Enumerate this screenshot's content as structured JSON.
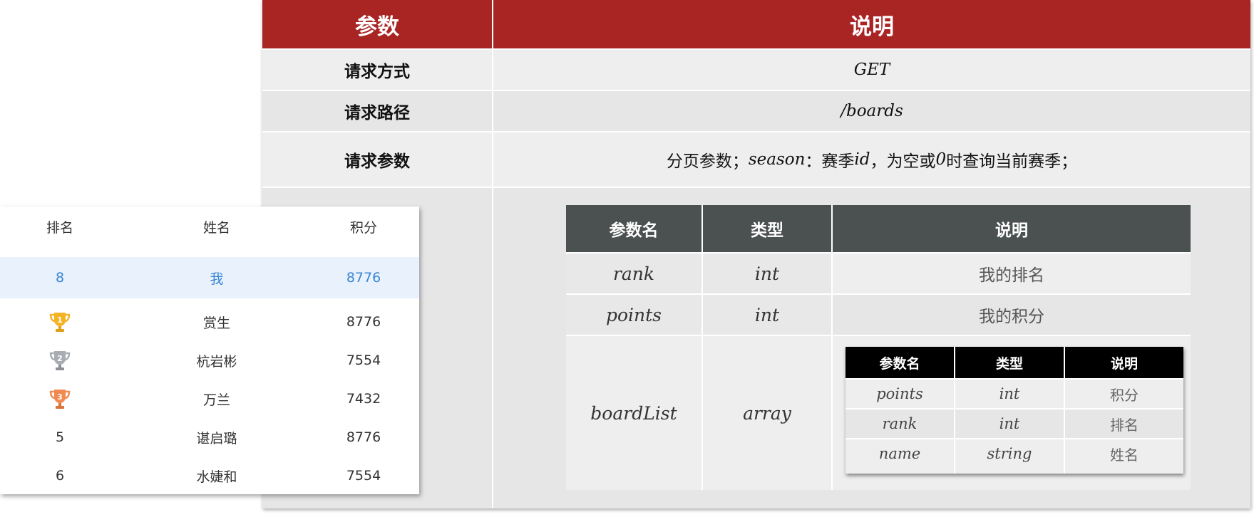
{
  "api": {
    "header": {
      "param": "参数",
      "desc": "说明"
    },
    "rows": [
      {
        "label": "请求方式",
        "value": "GET"
      },
      {
        "label": "请求路径",
        "value": "/boards"
      },
      {
        "label": "请求参数",
        "value_parts": [
          "分页参数；",
          "season",
          "：赛季",
          "id",
          "，为空或",
          "0",
          "时查询当前赛季；"
        ]
      }
    ]
  },
  "response": {
    "headers": [
      "参数名",
      "类型",
      "说明"
    ],
    "rows": [
      {
        "name": "rank",
        "type": "int",
        "desc": "我的排名"
      },
      {
        "name": "points",
        "type": "int",
        "desc": "我的积分"
      },
      {
        "name": "boardList",
        "type": "array"
      }
    ],
    "inner": {
      "headers": [
        "参数名",
        "类型",
        "说明"
      ],
      "rows": [
        {
          "name": "points",
          "type": "int",
          "desc": "积分"
        },
        {
          "name": "rank",
          "type": "int",
          "desc": "排名"
        },
        {
          "name": "name",
          "type": "string",
          "desc": "姓名"
        }
      ]
    }
  },
  "leaderboard": {
    "headers": [
      "排名",
      "姓名",
      "积分"
    ],
    "me": {
      "rank": "8",
      "name": "我",
      "points": "8776"
    },
    "rows": [
      {
        "rank": "1",
        "medal": "gold",
        "name": "赏生",
        "points": "8776"
      },
      {
        "rank": "2",
        "medal": "silver",
        "name": "杭岩彬",
        "points": "7554"
      },
      {
        "rank": "3",
        "medal": "bronze",
        "name": "万兰",
        "points": "7432"
      },
      {
        "rank": "5",
        "name": "谌启璐",
        "points": "8776"
      },
      {
        "rank": "6",
        "name": "水婕和",
        "points": "7554"
      }
    ],
    "colors": {
      "gold": "#f3b325",
      "silver": "#a9adb3",
      "bronze": "#f08a50",
      "highlight": "#3a86d4"
    },
    "icons": {
      "medal": "trophy-icon"
    }
  }
}
